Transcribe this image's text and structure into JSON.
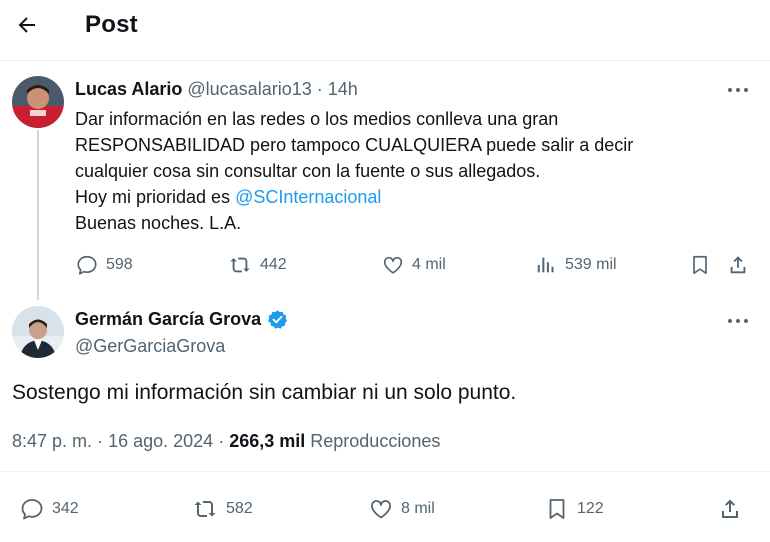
{
  "header": {
    "title": "Post"
  },
  "reply": {
    "author_name": "Lucas Alario",
    "author_handle": "@lucasalario13",
    "time": "14h",
    "text_lines": [
      "Dar información en las redes o los medios conlleva una gran",
      "RESPONSABILIDAD pero tampoco CUALQUIERA puede salir a decir",
      "cualquier cosa sin consultar con la fuente o sus allegados."
    ],
    "line4_prefix": "Hoy mi prioridad es ",
    "line4_mention": "@SCInternacional",
    "line5": "Buenas noches. L.A.",
    "counts": {
      "replies": "598",
      "reposts": "442",
      "likes": "4 mil",
      "views": "539 mil"
    }
  },
  "main": {
    "author_name": "Germán García Grova",
    "author_handle": "@GerGarciaGrova",
    "text": "Sostengo mi información sin cambiar ni un solo punto.",
    "time": "8:47 p. m.",
    "date": "16 ago. 2024",
    "views": "266,3 mil",
    "views_label": "Reproducciones",
    "counts": {
      "replies": "342",
      "reposts": "582",
      "likes": "8 mil",
      "bookmarks": "122"
    }
  },
  "colors": {
    "accent": "#1d9bf0",
    "text": "#0f1419",
    "muted": "#536471",
    "verified": "#1d9bf0"
  },
  "icons": [
    "arrow-left-icon",
    "more-icon",
    "reply-icon",
    "repost-icon",
    "like-icon",
    "views-icon",
    "bookmark-icon",
    "share-icon",
    "verified-icon"
  ]
}
